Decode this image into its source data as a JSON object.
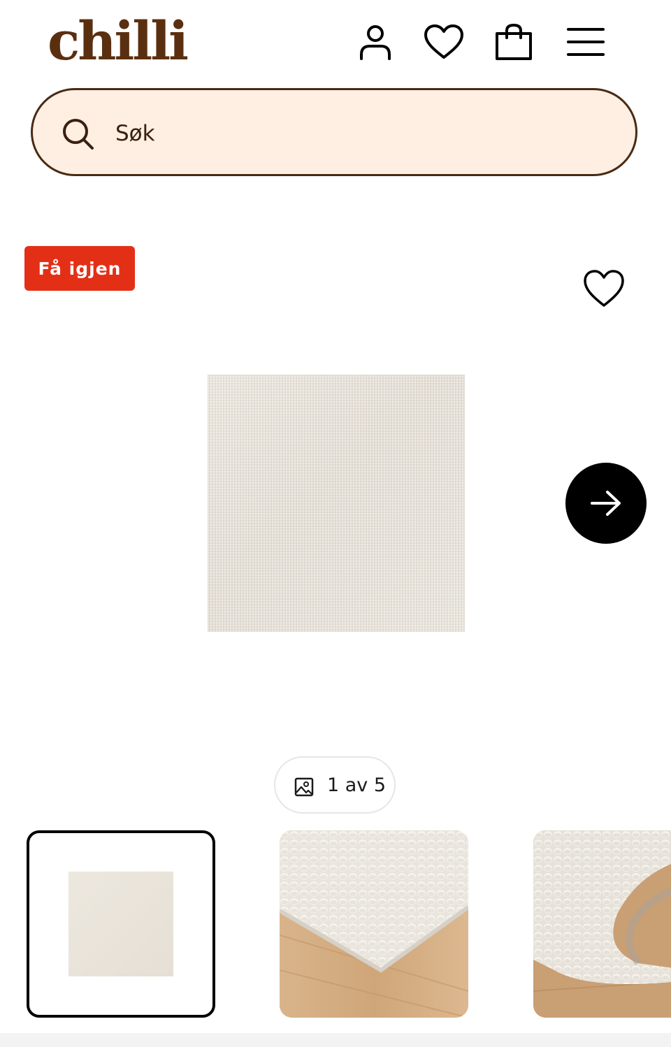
{
  "header": {
    "logo_text": "chilli",
    "brand_color": "#5a2f10",
    "icons": [
      "user-icon",
      "heart-icon",
      "shopping-bag-icon",
      "menu-icon"
    ]
  },
  "search": {
    "placeholder": "Søk",
    "value": "",
    "background_color": "#ffefe3"
  },
  "product": {
    "badge_label": "Få igjen",
    "badge_color": "#e42f17",
    "image_description_icon": "rug-image",
    "gallery_counter": "1 av 5",
    "current_image": 1,
    "total_images": 5
  },
  "thumbnails": [
    {
      "selected": true
    },
    {
      "selected": false
    },
    {
      "selected": false
    }
  ]
}
